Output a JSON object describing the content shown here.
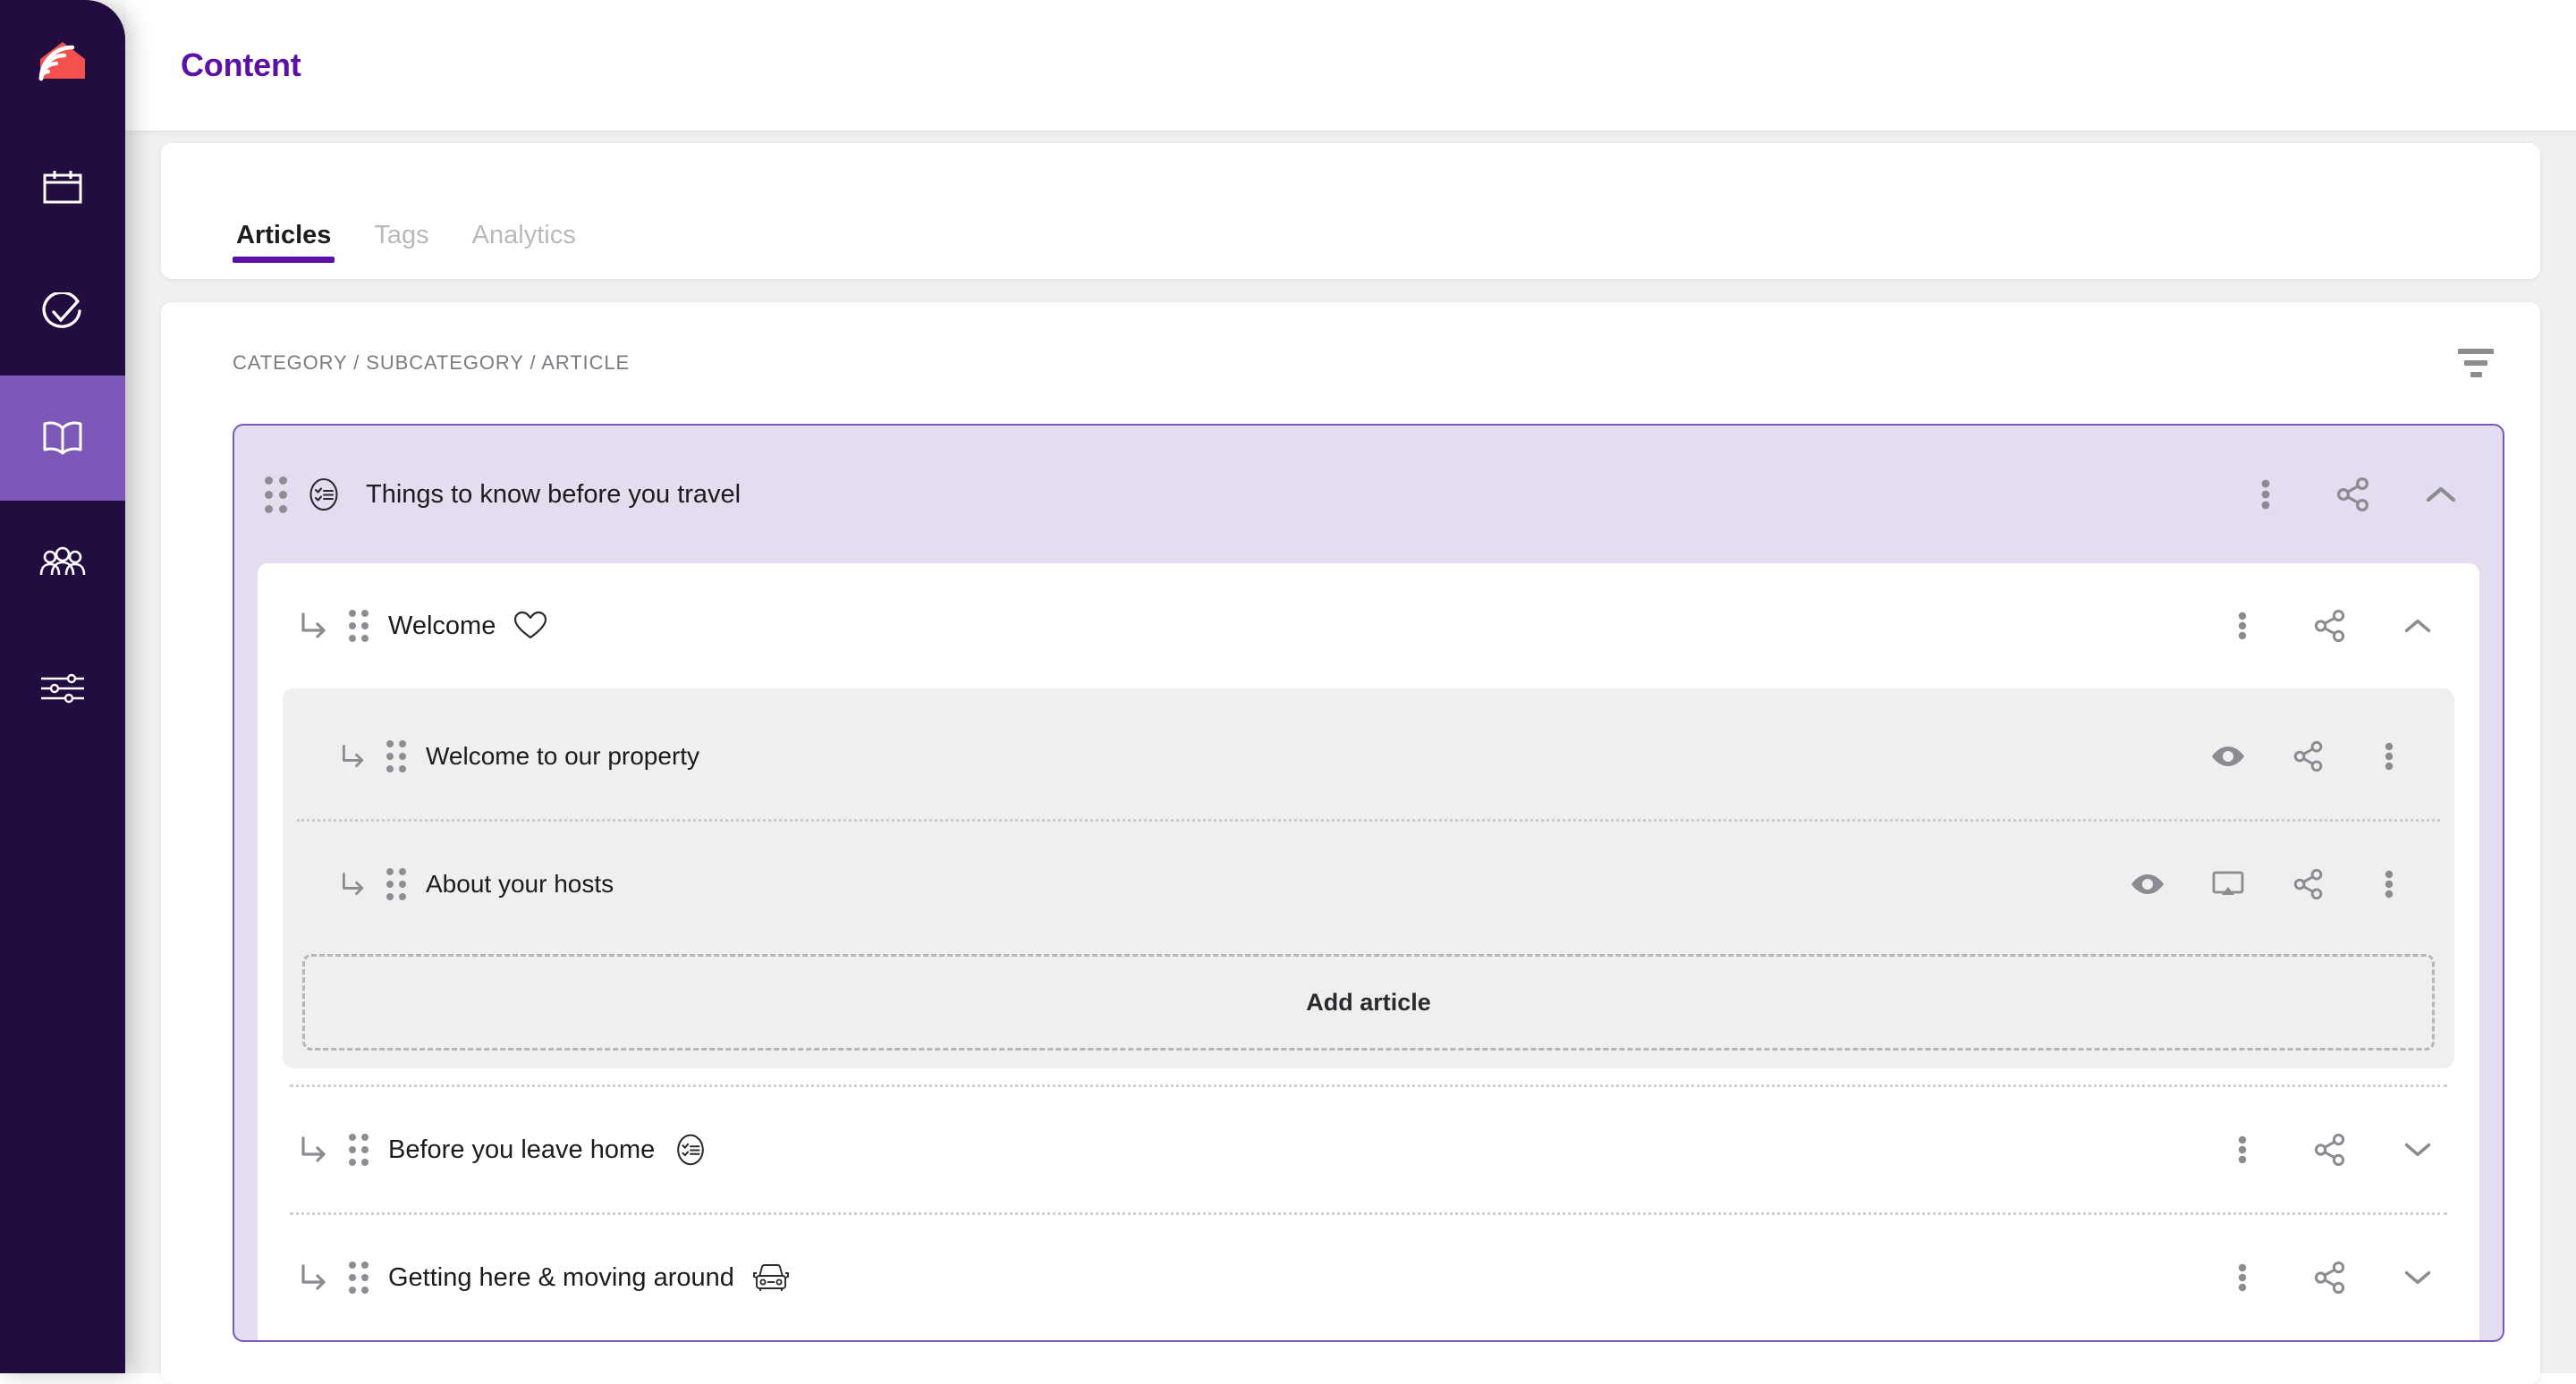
{
  "sidebar": {
    "logo": {
      "name": "home-signal-logo",
      "color": "#f4514e"
    },
    "items": [
      {
        "id": "calendar",
        "icon": "calendar-icon",
        "active": false
      },
      {
        "id": "tasks",
        "icon": "check-circle-icon",
        "active": false
      },
      {
        "id": "content",
        "icon": "book-open-icon",
        "active": true
      },
      {
        "id": "guests",
        "icon": "people-group-icon",
        "active": false
      },
      {
        "id": "settings",
        "icon": "sliders-icon",
        "active": false
      }
    ],
    "active_color": "#7c58b8",
    "background": "#230c40"
  },
  "header": {
    "title": "Content",
    "title_color": "#5b11a8"
  },
  "tabs": [
    {
      "label": "Articles",
      "active": true
    },
    {
      "label": "Tags",
      "active": false
    },
    {
      "label": "Analytics",
      "active": false
    }
  ],
  "content": {
    "breadcrumb": "CATEGORY / SUBCATEGORY / ARTICLE",
    "filter_icon": "filter-funnel-icon",
    "category": {
      "title": "Things to know before you travel",
      "icon": "checklist-circle-icon",
      "expanded": true,
      "border_color": "#7e59b5",
      "background": "#e3ddef",
      "actions": [
        "kebab-menu-icon",
        "share-icon",
        "chevron-up-icon"
      ]
    },
    "subcategories": [
      {
        "title": "Welcome",
        "icon": "heart-icon",
        "expanded": true,
        "actions": [
          "kebab-menu-icon",
          "share-icon",
          "chevron-up-icon"
        ],
        "articles": [
          {
            "title": "Welcome to our property",
            "actions": [
              "eye-icon",
              "share-icon",
              "kebab-menu-icon"
            ]
          },
          {
            "title": "About your hosts",
            "actions": [
              "eye-icon",
              "cast-screen-icon",
              "share-icon",
              "kebab-menu-icon"
            ]
          }
        ],
        "add_article_label": "Add article"
      },
      {
        "title": "Before you leave home",
        "icon": "checklist-circle-icon",
        "expanded": false,
        "actions": [
          "kebab-menu-icon",
          "share-icon",
          "chevron-down-icon"
        ],
        "articles": []
      },
      {
        "title": "Getting here & moving around",
        "icon": "car-front-icon",
        "expanded": false,
        "actions": [
          "kebab-menu-icon",
          "share-icon",
          "chevron-down-icon"
        ],
        "articles": []
      }
    ]
  }
}
